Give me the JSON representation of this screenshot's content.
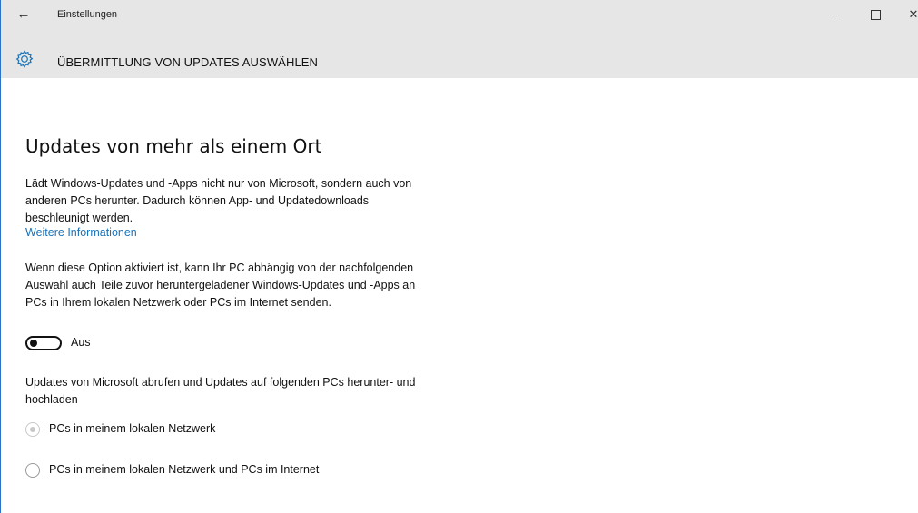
{
  "window": {
    "app_title": "Einstellungen",
    "icons": {
      "back": "back-arrow-icon",
      "minimize": "minimize-icon",
      "maximize": "maximize-icon",
      "close": "close-icon",
      "page": "gear-icon"
    },
    "glyphs": {
      "back": "←",
      "minimize": "–",
      "close": "✕"
    }
  },
  "page": {
    "title": "ÜBERMITTLUNG VON UPDATES AUSWÄHLEN",
    "section_title": "Updates von mehr als einem Ort",
    "description1": "Lädt Windows-Updates und -Apps nicht nur von Microsoft, sondern auch von anderen PCs herunter. Dadurch können App- und Updatedownloads beschleunigt werden.",
    "more_info_link": "Weitere Informationen",
    "description2": "Wenn diese Option aktiviert ist, kann Ihr PC abhängig von der nachfolgenden Auswahl auch Teile zuvor heruntergeladener Windows-Updates und -Apps an PCs in Ihrem lokalen Netzwerk oder PCs im Internet senden.",
    "toggle": {
      "state": "off",
      "label": "Aus"
    },
    "description3": "Updates von Microsoft abrufen und Updates auf folgenden PCs herunter- und hochladen",
    "radio_options": [
      {
        "label": "PCs in meinem lokalen Netzwerk",
        "selected": true,
        "disabled": true
      },
      {
        "label": "PCs in meinem lokalen Netzwerk und PCs im Internet",
        "selected": false,
        "disabled": false
      }
    ]
  },
  "colors": {
    "chrome_bg": "#e6e6e6",
    "link": "#1a73b8",
    "accent_icon": "#1a73b8",
    "window_border": "#2b73c6"
  }
}
